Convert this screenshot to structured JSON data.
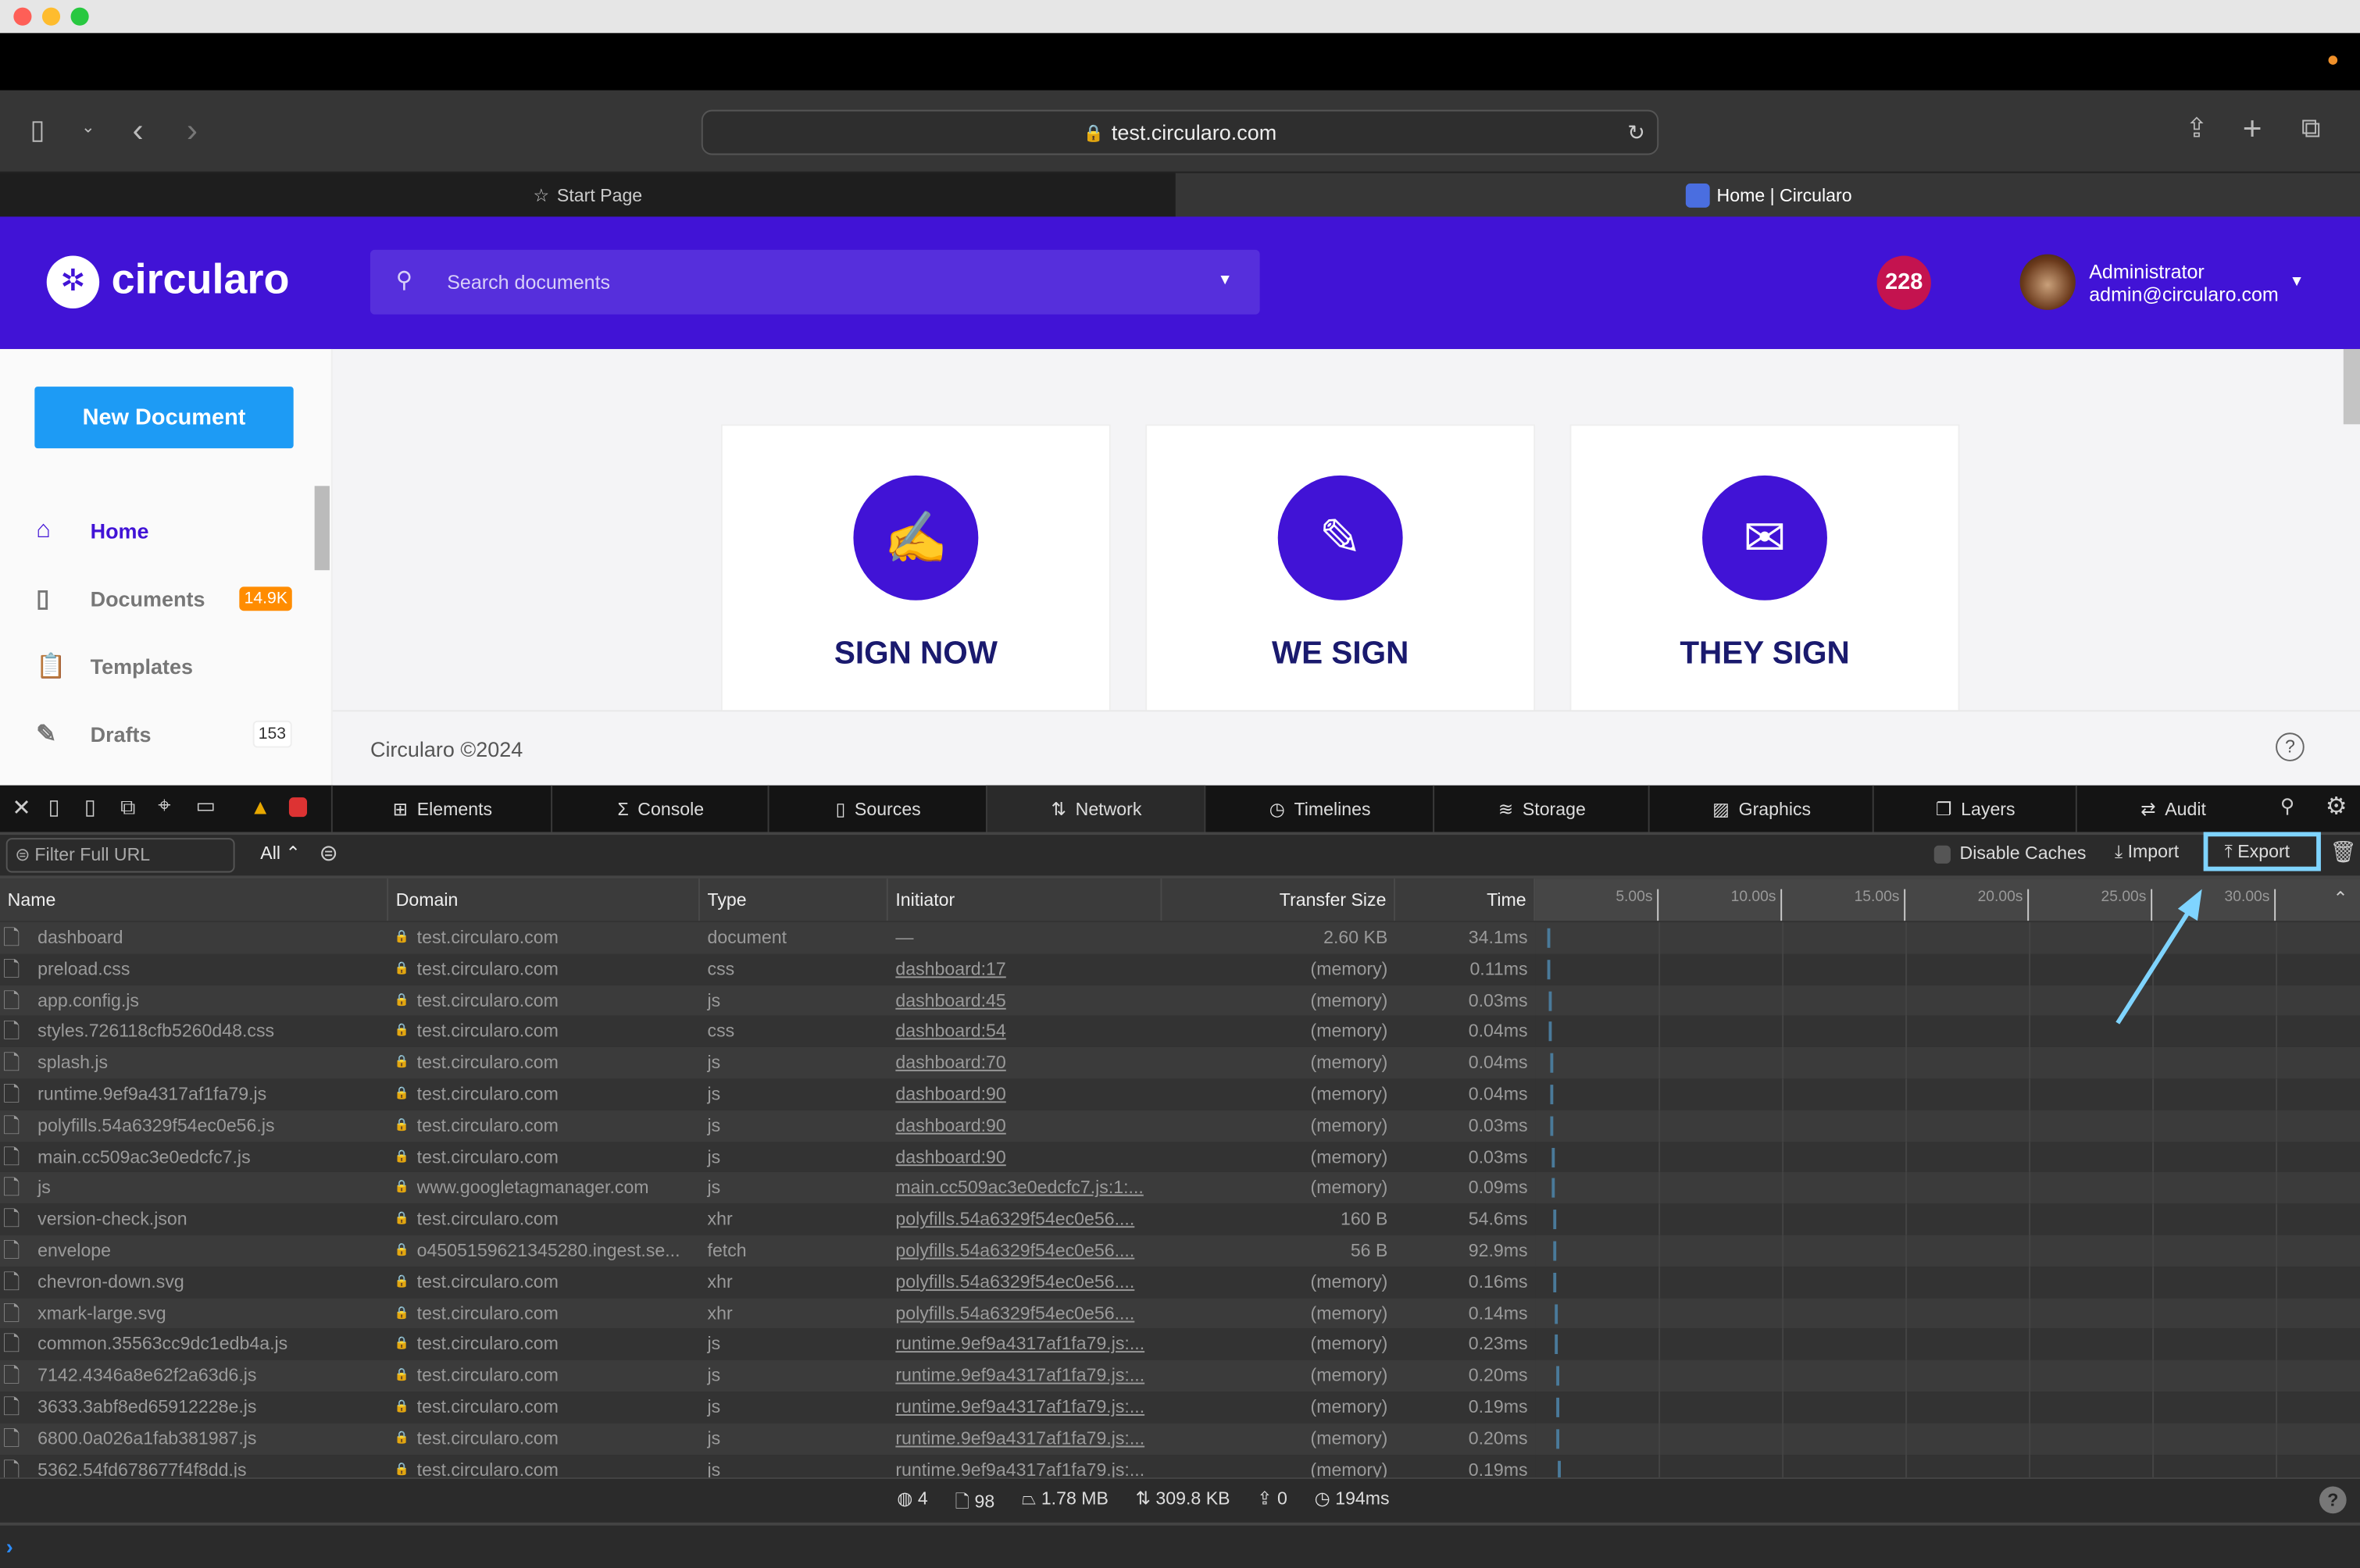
{
  "browser": {
    "url": "test.circularo.com",
    "tabs": [
      {
        "label": "Start Page",
        "icon": "star-icon"
      },
      {
        "label": "Home | Circularo",
        "icon": "circularo-favicon"
      }
    ]
  },
  "app": {
    "logo": "circularo",
    "search_placeholder": "Search documents",
    "notification_count": "228",
    "user_name": "Administrator",
    "user_email": "admin@circularo.com",
    "brand_color": "#4113d6"
  },
  "sidebar": {
    "new_document": "New Document",
    "items": [
      {
        "label": "Home",
        "icon": "home-icon",
        "badge": ""
      },
      {
        "label": "Documents",
        "icon": "document-icon",
        "badge": "14.9K"
      },
      {
        "label": "Templates",
        "icon": "clipboard-icon",
        "badge": ""
      },
      {
        "label": "Drafts",
        "icon": "pencil-icon",
        "badge": "153"
      }
    ]
  },
  "cards": [
    {
      "label": "SIGN NOW",
      "icon": "signature-icon"
    },
    {
      "label": "WE SIGN",
      "icon": "document-sign-icon"
    },
    {
      "label": "THEY SIGN",
      "icon": "envelope-icon"
    }
  ],
  "footer": {
    "text": "Circularo ©2024"
  },
  "devtools": {
    "tabs": [
      {
        "label": "Elements",
        "icon": "elements-icon"
      },
      {
        "label": "Console",
        "icon": "console-icon"
      },
      {
        "label": "Sources",
        "icon": "file-icon"
      },
      {
        "label": "Network",
        "icon": "network-icon",
        "active": true
      },
      {
        "label": "Timelines",
        "icon": "clock-icon"
      },
      {
        "label": "Storage",
        "icon": "database-icon"
      },
      {
        "label": "Graphics",
        "icon": "image-icon"
      },
      {
        "label": "Layers",
        "icon": "layers-icon"
      },
      {
        "label": "Audit",
        "icon": "audit-icon"
      }
    ],
    "filter_placeholder": "Filter Full URL",
    "type_filter": "All",
    "disable_caches": "Disable Caches",
    "import": "Import",
    "export": "Export",
    "columns": [
      "Name",
      "Domain",
      "Type",
      "Initiator",
      "Transfer Size",
      "Time"
    ],
    "timeline_ticks": [
      "5.00s",
      "10.00s",
      "15.00s",
      "20.00s",
      "25.00s",
      "30.00s"
    ],
    "rows": [
      [
        "dashboard",
        "test.circularo.com",
        "document",
        "—",
        "2.60 KB",
        "34.1ms"
      ],
      [
        "preload.css",
        "test.circularo.com",
        "css",
        "dashboard:17",
        "(memory)",
        "0.11ms"
      ],
      [
        "app.config.js",
        "test.circularo.com",
        "js",
        "dashboard:45",
        "(memory)",
        "0.03ms"
      ],
      [
        "styles.726118cfb5260d48.css",
        "test.circularo.com",
        "css",
        "dashboard:54",
        "(memory)",
        "0.04ms"
      ],
      [
        "splash.js",
        "test.circularo.com",
        "js",
        "dashboard:70",
        "(memory)",
        "0.04ms"
      ],
      [
        "runtime.9ef9a4317af1fa79.js",
        "test.circularo.com",
        "js",
        "dashboard:90",
        "(memory)",
        "0.04ms"
      ],
      [
        "polyfills.54a6329f54ec0e56.js",
        "test.circularo.com",
        "js",
        "dashboard:90",
        "(memory)",
        "0.03ms"
      ],
      [
        "main.cc509ac3e0edcfc7.js",
        "test.circularo.com",
        "js",
        "dashboard:90",
        "(memory)",
        "0.03ms"
      ],
      [
        "js",
        "www.googletagmanager.com",
        "js",
        "main.cc509ac3e0edcfc7.js:1:...",
        "(memory)",
        "0.09ms"
      ],
      [
        "version-check.json",
        "test.circularo.com",
        "xhr",
        "polyfills.54a6329f54ec0e56....",
        "160 B",
        "54.6ms"
      ],
      [
        "envelope",
        "o4505159621345280.ingest.se...",
        "fetch",
        "polyfills.54a6329f54ec0e56....",
        "56 B",
        "92.9ms"
      ],
      [
        "chevron-down.svg",
        "test.circularo.com",
        "xhr",
        "polyfills.54a6329f54ec0e56....",
        "(memory)",
        "0.16ms"
      ],
      [
        "xmark-large.svg",
        "test.circularo.com",
        "xhr",
        "polyfills.54a6329f54ec0e56....",
        "(memory)",
        "0.14ms"
      ],
      [
        "common.35563cc9dc1edb4a.js",
        "test.circularo.com",
        "js",
        "runtime.9ef9a4317af1fa79.js:...",
        "(memory)",
        "0.23ms"
      ],
      [
        "7142.4346a8e62f2a63d6.js",
        "test.circularo.com",
        "js",
        "runtime.9ef9a4317af1fa79.js:...",
        "(memory)",
        "0.20ms"
      ],
      [
        "3633.3abf8ed65912228e.js",
        "test.circularo.com",
        "js",
        "runtime.9ef9a4317af1fa79.js:...",
        "(memory)",
        "0.19ms"
      ],
      [
        "6800.0a026a1fab381987.js",
        "test.circularo.com",
        "js",
        "runtime.9ef9a4317af1fa79.js:...",
        "(memory)",
        "0.20ms"
      ],
      [
        "5362.54fd678677f4f8dd.js",
        "test.circularo.com",
        "js",
        "runtime.9ef9a4317af1fa79.js:...",
        "(memory)",
        "0.19ms"
      ]
    ],
    "summary": {
      "domains": "4",
      "requests": "98",
      "resources_size": "1.78 MB",
      "transferred": "309.8 KB",
      "redirects": "0",
      "load_time": "194ms"
    }
  },
  "annotation": {
    "color": "#7fd4ff",
    "target": "Export"
  }
}
